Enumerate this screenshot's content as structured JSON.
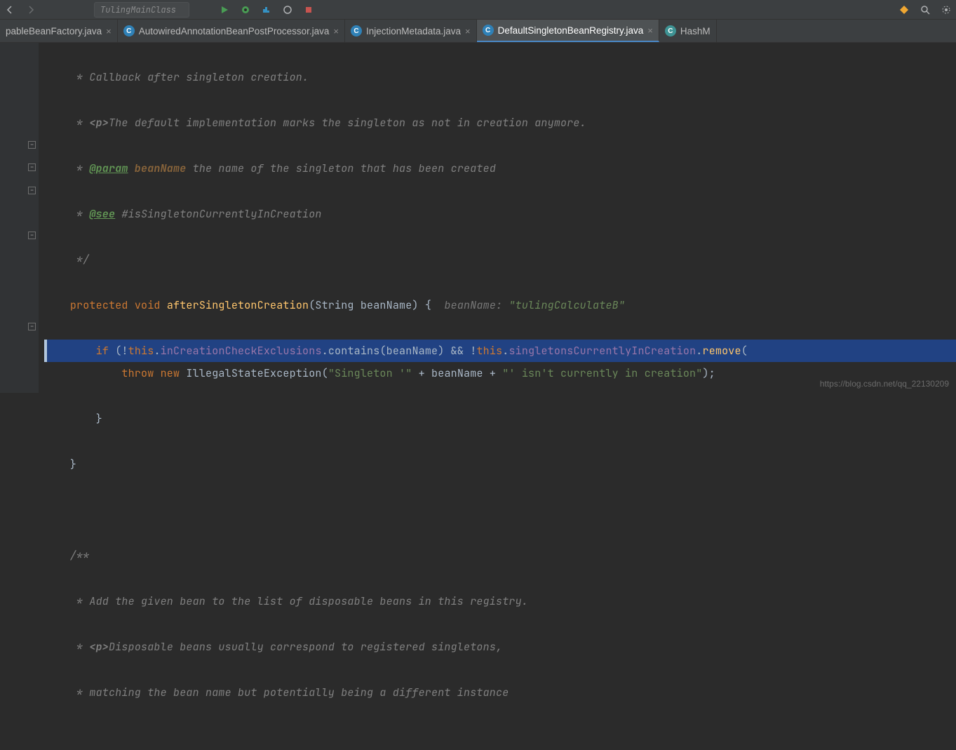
{
  "toolbar": {
    "run_config": "TulingMainClass"
  },
  "tabs": [
    {
      "label": "pableBeanFactory.java",
      "icon": "c",
      "active": false,
      "truncated_left": true
    },
    {
      "label": "AutowiredAnnotationBeanPostProcessor.java",
      "icon": "c",
      "active": false
    },
    {
      "label": "InjectionMetadata.java",
      "icon": "c",
      "active": false
    },
    {
      "label": "DefaultSingletonBeanRegistry.java",
      "icon": "c",
      "active": true
    },
    {
      "label": "HashM",
      "icon": "c2",
      "active": false,
      "truncated_right": true
    }
  ],
  "code": {
    "l1": "     * Callback after singleton creation.",
    "l2a": "     * ",
    "l2b": "<p>",
    "l2c": "The default implementation marks the singleton as not in creation anymore.",
    "l3a": "     * ",
    "l3b": "@param",
    "l3c": " beanName",
    "l3d": " the name of the singleton that has been created",
    "l4a": "     * ",
    "l4b": "@see",
    "l4c": " #isSingletonCurrentlyInCreation",
    "l5": "     */",
    "l6a": "    ",
    "l6b": "protected void ",
    "l6c": "afterSingletonCreation",
    "l6d": "(String beanName) {  ",
    "l6e": "beanName: ",
    "l6f": "\"tulingCalculateB\"",
    "l7a": "        ",
    "l7b": "if ",
    "l7c": "(!",
    "l7d": "this",
    "l7e": ".",
    "l7f": "inCreationCheckExclusions",
    "l7g": ".contains(beanName) && !",
    "l7h": "this",
    "l7i": ".",
    "l7j": "singletonsCurrentlyInCreation",
    "l7k": ".",
    "l7l": "remove",
    "l7m": "(",
    "l8a": "            ",
    "l8b": "throw new ",
    "l8c": "IllegalStateException(",
    "l8d": "\"Singleton '\"",
    "l8e": " + beanName + ",
    "l8f": "\"' isn't currently in creation\"",
    "l8g": ");",
    "l9": "        }",
    "l10": "    }",
    "l11": "",
    "l12": "",
    "l13": "    /**",
    "l14": "     * Add the given bean to the list of disposable beans in this registry.",
    "l15a": "     * ",
    "l15b": "<p>",
    "l15c": "Disposable beans usually correspond to registered singletons,",
    "l16": "     * matching the bean name but potentially being a different instance"
  },
  "watermark": "https://blog.csdn.net/qq_22130209"
}
